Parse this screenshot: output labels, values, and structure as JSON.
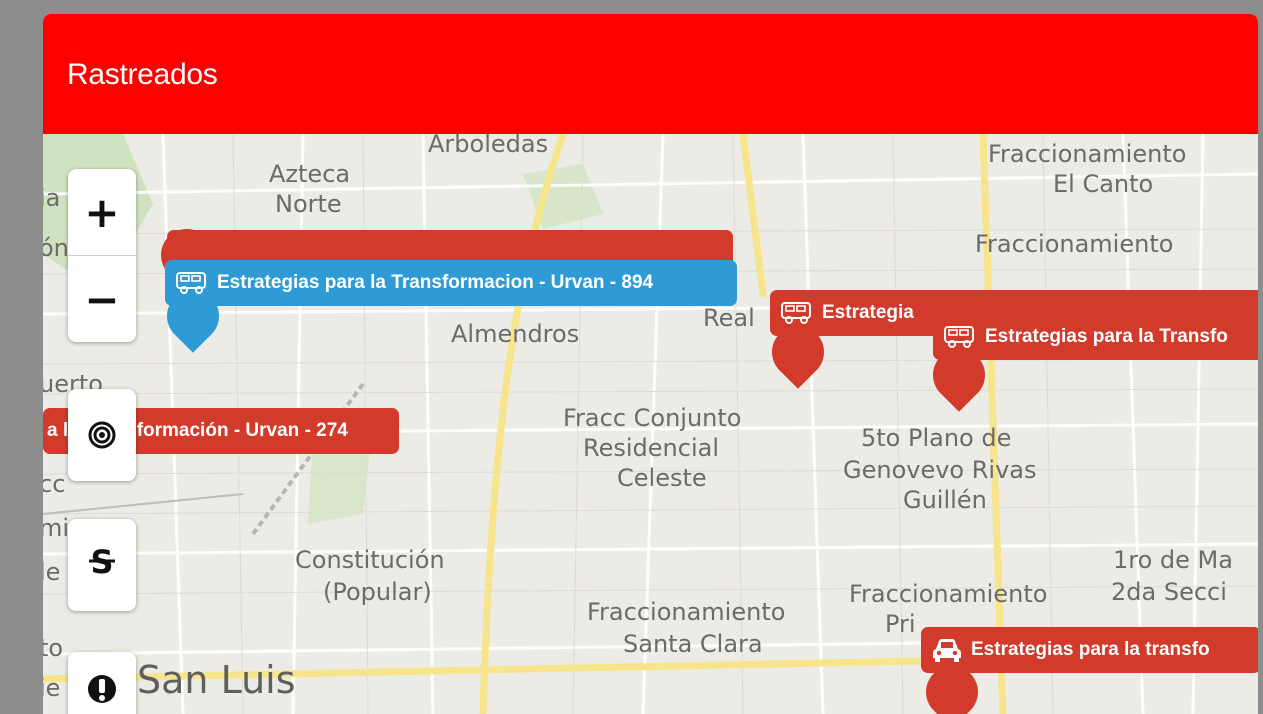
{
  "header": {
    "title": "Rastreados"
  },
  "colors": {
    "header": "#ff0000",
    "marker_red": "#d23a2b",
    "marker_blue": "#2f9bd6"
  },
  "map": {
    "places": {
      "arboledas": "Arboledas",
      "azteca": "Azteca",
      "norte": "Norte",
      "fracc_el_canto_1": "Fraccionamiento",
      "fracc_el_canto_2": "El Canto",
      "fraccionamiento_right": "Fraccionamiento",
      "almendros": "Almendros",
      "real": "Real",
      "fracc_conjunto_1": "Fracc Conjunto",
      "fracc_conjunto_2": "Residencial",
      "fracc_conjunto_3": "Celeste",
      "quinto_plano_1": "5to Plano de",
      "quinto_plano_2": "Genovevo Rivas",
      "quinto_plano_3": "Guillén",
      "constitucion_1": "Constitución",
      "constitucion_2": "(Popular)",
      "santa_clara_1": "Fraccionamiento",
      "santa_clara_2": "Santa Clara",
      "fracc_pri_1": "Fraccionamiento",
      "fracc_pri_2": "Pri",
      "primero_mayo_1": "1ro de Ma",
      "primero_mayo_2": "2da Secci",
      "san_luis": "San Luis",
      "left_ia": "ia",
      "left_on": "ón",
      "left_uerto": "uerto",
      "left_to": "to",
      "left_cc": "cc",
      "left_mi": "mi",
      "left_le": "le",
      "left_ie": "ie"
    },
    "controls": {
      "zoom_in": "+",
      "zoom_out": "−",
      "locate_icon": "target-icon",
      "route_icon": "strikethrough-s-icon",
      "alert_icon": "alert-icon"
    },
    "markers": [
      {
        "label": "Estrategias para la Transformacion - Urvan - 894",
        "color": "blue",
        "icon": "van-icon"
      },
      {
        "label": "formación - Urvan - 274",
        "color": "red",
        "icon": ""
      },
      {
        "label": "Estrategia",
        "color": "red",
        "icon": "van-icon"
      },
      {
        "label": "Estrategias para la Transfo",
        "color": "red",
        "icon": "van-icon"
      },
      {
        "label": "Estrategias para la transfo",
        "color": "red",
        "icon": "car-icon"
      }
    ],
    "marker_274_prefix": "a la"
  }
}
